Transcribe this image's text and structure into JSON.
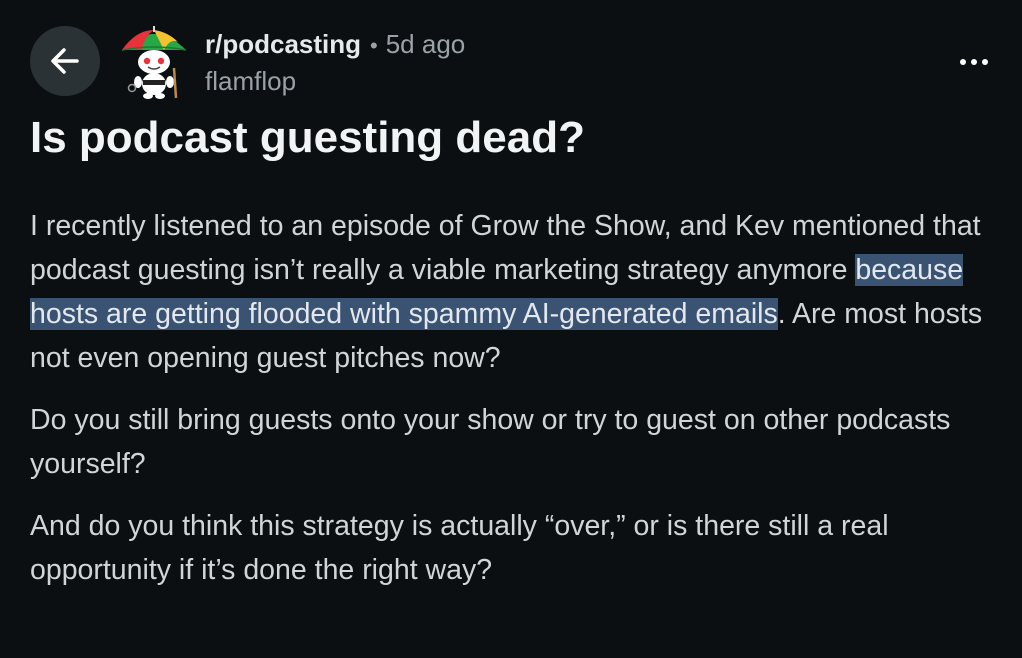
{
  "header": {
    "subreddit": "r/podcasting",
    "separator": "•",
    "time_ago": "5d ago",
    "author": "flamflop",
    "back_icon": "arrow-left-icon",
    "more_icon": "ellipsis-icon",
    "avatar_icon": "snoo-avatar-with-umbrella-hat"
  },
  "post": {
    "title": "Is podcast guesting dead?",
    "paragraphs": [
      {
        "before": "I recently listened to an episode of Grow the Show, and Kev mentioned that podcast guesting isn’t really a viable marketing strategy anymore ",
        "highlight": "because hosts are getting flooded with spammy AI-generated emails",
        "after": ". Are most hosts not even opening guest pitches now?"
      },
      {
        "text": "Do you still bring guests onto your show or try to guest on other podcasts yourself?"
      },
      {
        "text": "And do you think this strategy is actually “over,” or is there still a real opportunity if it’s done the right way?"
      }
    ]
  },
  "colors": {
    "background": "#0b0f12",
    "back_button_bg": "#2a3236",
    "text_primary": "#f1f3f4",
    "text_secondary": "#9ba2a6",
    "selection_highlight": "#3b5372"
  }
}
